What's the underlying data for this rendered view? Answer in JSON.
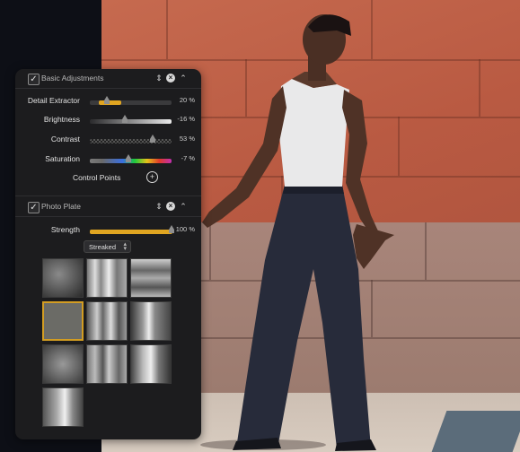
{
  "basic_adjustments": {
    "title": "Basic Adjustments",
    "enabled": true,
    "sliders": [
      {
        "label": "Detail Extractor",
        "value": "20 %",
        "level": 0.2
      },
      {
        "label": "Brightness",
        "value": "-16 %",
        "level": 0.42
      },
      {
        "label": "Contrast",
        "value": "53 %",
        "level": 0.76
      },
      {
        "label": "Saturation",
        "value": "-7 %",
        "level": 0.46
      }
    ],
    "control_points_label": "Control Points"
  },
  "photo_plate": {
    "title": "Photo Plate",
    "enabled": true,
    "strength_label": "Strength",
    "strength_value": "100 %",
    "strength_level": 1.0,
    "mode": "Streaked",
    "thumbnails": [
      "texture-1",
      "texture-2",
      "texture-3",
      "texture-4",
      "texture-5",
      "texture-6",
      "texture-7",
      "texture-8",
      "texture-9",
      "texture-10"
    ],
    "selected_thumbnail": 3
  },
  "icons": {
    "checkbox": "checkmark-icon",
    "stepper": "up-down-arrows-icon",
    "reset": "close-circle-icon",
    "collapse": "chevron-up-icon",
    "control_point_add": "add-control-point-icon"
  },
  "colors": {
    "panel_bg": "#1c1c1e",
    "accent": "#e0a521",
    "text": "#e2e2e2"
  }
}
